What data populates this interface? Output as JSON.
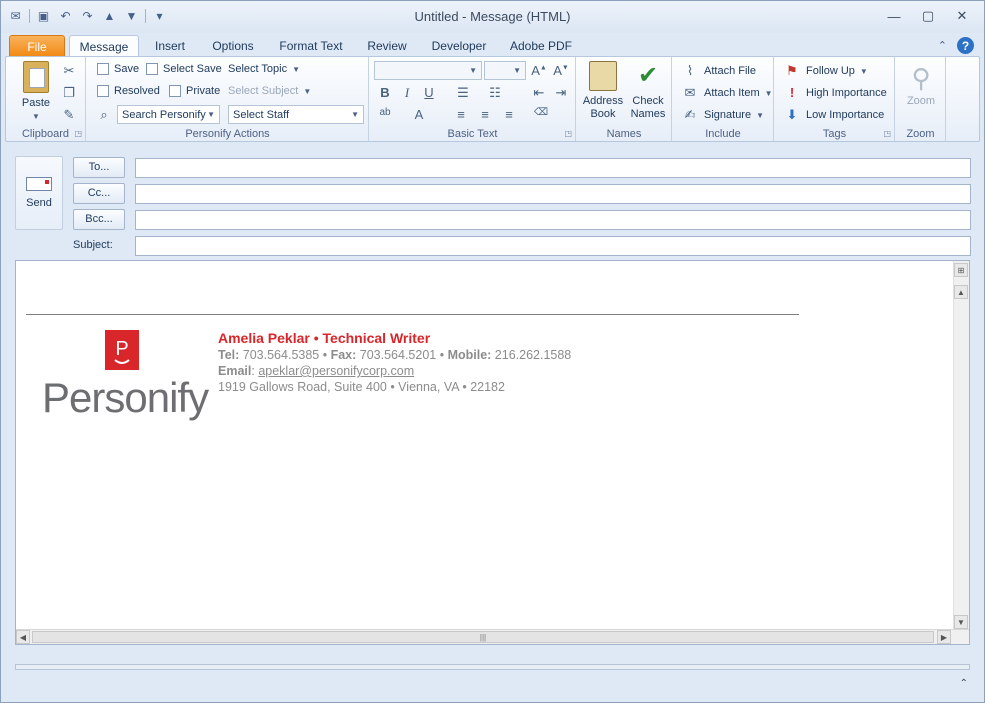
{
  "window": {
    "title": "Untitled  -  Message (HTML)"
  },
  "tabs": [
    {
      "label": "File"
    },
    {
      "label": "Message"
    },
    {
      "label": "Insert"
    },
    {
      "label": "Options"
    },
    {
      "label": "Format Text"
    },
    {
      "label": "Review"
    },
    {
      "label": "Developer"
    },
    {
      "label": "Adobe PDF"
    }
  ],
  "ribbon": {
    "clipboard": {
      "label": "Clipboard",
      "paste": "Paste"
    },
    "personify": {
      "label": "Personify Actions",
      "save": "Save",
      "select_save": "Select Save",
      "select_topic": "Select Topic",
      "resolved": "Resolved",
      "private": "Private",
      "select_subject": "Select Subject",
      "search": "Search Personify",
      "select_staff": "Select Staff"
    },
    "basic_text": {
      "label": "Basic Text"
    },
    "names": {
      "label": "Names",
      "address_book_1": "Address",
      "address_book_2": "Book",
      "check_names_1": "Check",
      "check_names_2": "Names"
    },
    "include": {
      "label": "Include",
      "attach_file": "Attach File",
      "attach_item": "Attach Item",
      "signature": "Signature"
    },
    "tags": {
      "label": "Tags",
      "follow_up": "Follow Up",
      "high_importance": "High Importance",
      "low_importance": "Low Importance"
    },
    "zoom": {
      "label": "Zoom",
      "zoom": "Zoom"
    }
  },
  "form": {
    "send": "Send",
    "to": "To...",
    "cc": "Cc...",
    "bcc": "Bcc...",
    "subject_label": "Subject:",
    "to_value": "",
    "cc_value": "",
    "bcc_value": "",
    "subject_value": ""
  },
  "signature": {
    "name_line": "Amelia Peklar • Technical Writer",
    "tel_label": "Tel:",
    "tel": "703.564.5385",
    "fax_label": "Fax:",
    "fax": "703.564.5201",
    "mobile_label": "Mobile:",
    "mobile": "216.262.1588",
    "email_label": "Email",
    "email": "apeklar@personifycorp.com",
    "address": "1919 Gallows Road, Suite 400 • Vienna, VA • 22182",
    "logo_text": "Personify"
  },
  "colors": {
    "accent": "#d9262a",
    "file_tab": "#f18a15",
    "ribbon_bg": "#dfe9f5"
  }
}
